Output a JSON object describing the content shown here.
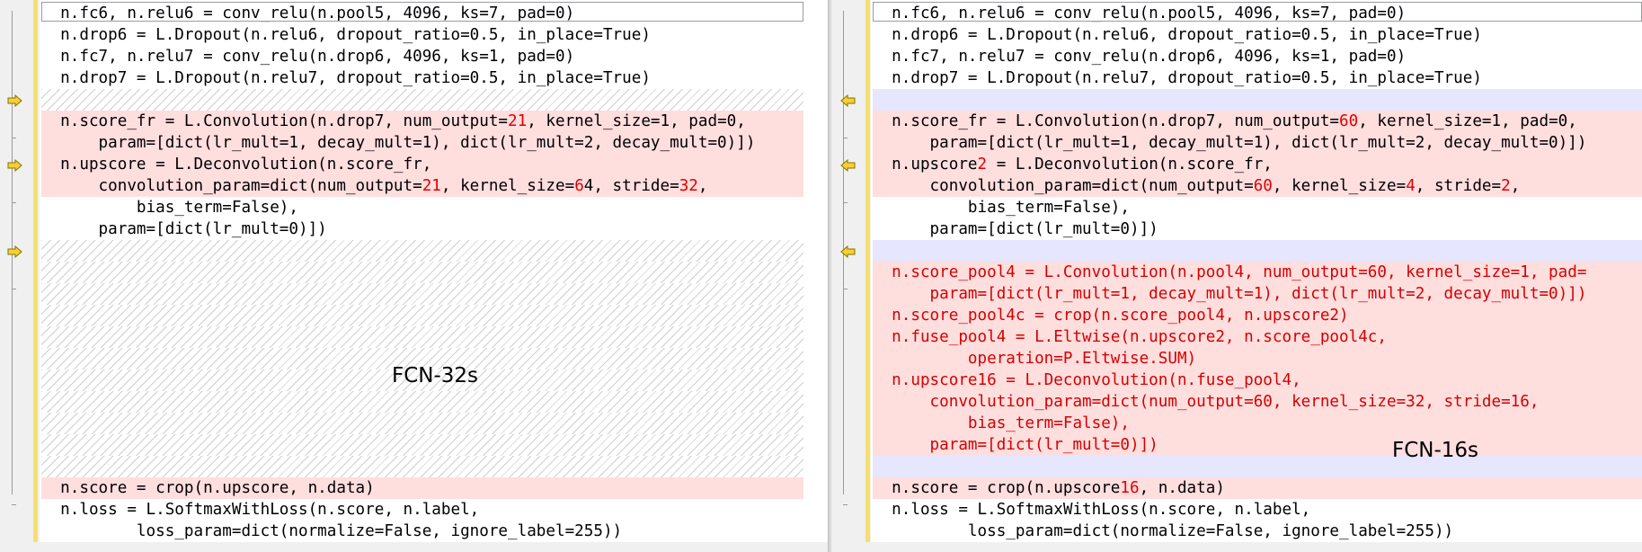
{
  "left": {
    "label": "FCN-32s",
    "lines": [
      {
        "kind": "normal",
        "spans": [
          {
            "t": "  n.fc6, n.relu6 = conv_relu(n.pool5, 4096, ks=7, pad=0)"
          }
        ]
      },
      {
        "kind": "normal",
        "spans": [
          {
            "t": "  n.drop6 = L.Dropout(n.relu6, dropout_ratio=0.5, in_place=True)"
          }
        ]
      },
      {
        "kind": "normal",
        "spans": [
          {
            "t": "  n.fc7, n.relu7 = conv_relu(n.drop6, 4096, ks=1, pad=0)"
          }
        ]
      },
      {
        "kind": "normal",
        "spans": [
          {
            "t": "  n.drop7 = L.Dropout(n.relu7, dropout_ratio=0.5, in_place=True)"
          }
        ]
      },
      {
        "kind": "hatch",
        "spans": []
      },
      {
        "kind": "changed",
        "spans": [
          {
            "t": "  n.score_fr = L.Convolution(n.drop7, num_output="
          },
          {
            "t": "21",
            "red": true
          },
          {
            "t": ", kernel_size=1, pad=0,"
          }
        ]
      },
      {
        "kind": "changed",
        "spans": [
          {
            "t": "      param=[dict(lr_mult=1, decay_mult=1), dict(lr_mult=2, decay_mult=0)])"
          }
        ]
      },
      {
        "kind": "changed",
        "spans": [
          {
            "t": "  n.upscore = L.Deconvolution(n.score_fr,"
          }
        ]
      },
      {
        "kind": "changed",
        "spans": [
          {
            "t": "      convolution_param=dict(num_output="
          },
          {
            "t": "21",
            "red": true
          },
          {
            "t": ", kernel_size="
          },
          {
            "t": "6",
            "red": true
          },
          {
            "t": "4, stride="
          },
          {
            "t": "32",
            "red": true
          },
          {
            "t": ","
          }
        ]
      },
      {
        "kind": "normal",
        "spans": [
          {
            "t": "          bias_term=False),"
          }
        ]
      },
      {
        "kind": "normal",
        "spans": [
          {
            "t": "      param=[dict(lr_mult=0)])"
          }
        ]
      },
      {
        "kind": "hatch",
        "spans": []
      },
      {
        "kind": "hatch",
        "spans": []
      },
      {
        "kind": "hatch",
        "spans": []
      },
      {
        "kind": "hatch",
        "spans": []
      },
      {
        "kind": "hatch",
        "spans": []
      },
      {
        "kind": "hatch",
        "spans": []
      },
      {
        "kind": "hatch",
        "spans": []
      },
      {
        "kind": "hatch",
        "spans": []
      },
      {
        "kind": "hatch",
        "spans": []
      },
      {
        "kind": "hatch",
        "spans": []
      },
      {
        "kind": "hatch",
        "spans": []
      },
      {
        "kind": "changed",
        "spans": [
          {
            "t": "  n.score = crop(n.upscore, n.data)"
          }
        ]
      },
      {
        "kind": "normal",
        "spans": [
          {
            "t": "  n.loss = L.SoftmaxWithLoss(n.score, n.label,"
          }
        ]
      },
      {
        "kind": "normal",
        "spans": [
          {
            "t": "          loss_param=dict(normalize=False, ignore_label=255))"
          }
        ]
      }
    ]
  },
  "right": {
    "label": "FCN-16s",
    "lines": [
      {
        "kind": "normal",
        "spans": [
          {
            "t": "  n.fc6, n.relu6 = conv_relu(n.pool5, 4096, ks=7, pad=0)"
          }
        ]
      },
      {
        "kind": "normal",
        "spans": [
          {
            "t": "  n.drop6 = L.Dropout(n.relu6, dropout_ratio=0.5, in_place=True)"
          }
        ]
      },
      {
        "kind": "normal",
        "spans": [
          {
            "t": "  n.fc7, n.relu7 = conv_relu(n.drop6, 4096, ks=1, pad=0)"
          }
        ]
      },
      {
        "kind": "normal",
        "spans": [
          {
            "t": "  n.drop7 = L.Dropout(n.relu7, dropout_ratio=0.5, in_place=True)"
          }
        ]
      },
      {
        "kind": "empty",
        "spans": []
      },
      {
        "kind": "changed",
        "spans": [
          {
            "t": "  n.score_fr = L.Convolution(n.drop7, num_output="
          },
          {
            "t": "60",
            "red": true
          },
          {
            "t": ", kernel_size=1, pad=0,"
          }
        ]
      },
      {
        "kind": "changed",
        "spans": [
          {
            "t": "      param=[dict(lr_mult=1, decay_mult=1), dict(lr_mult=2, decay_mult=0)])"
          }
        ]
      },
      {
        "kind": "changed",
        "spans": [
          {
            "t": "  n.upscore"
          },
          {
            "t": "2",
            "red": true
          },
          {
            "t": " = L.Deconvolution(n.score_fr,"
          }
        ]
      },
      {
        "kind": "changed",
        "spans": [
          {
            "t": "      convolution_param=dict(num_output="
          },
          {
            "t": "60",
            "red": true
          },
          {
            "t": ", kernel_size="
          },
          {
            "t": "4",
            "red": true
          },
          {
            "t": ", stride="
          },
          {
            "t": "2",
            "red": true
          },
          {
            "t": ","
          }
        ]
      },
      {
        "kind": "normal",
        "spans": [
          {
            "t": "          bias_term=False),"
          }
        ]
      },
      {
        "kind": "normal",
        "spans": [
          {
            "t": "      param=[dict(lr_mult=0)])"
          }
        ]
      },
      {
        "kind": "empty",
        "spans": []
      },
      {
        "kind": "added",
        "spans": [
          {
            "t": "  n.score_pool4 = L.Convolution(n.pool4, num_output=60, kernel_size=1, pad="
          }
        ]
      },
      {
        "kind": "added",
        "spans": [
          {
            "t": "      param=[dict(lr_mult=1, decay_mult=1), dict(lr_mult=2, decay_mult=0)])"
          }
        ]
      },
      {
        "kind": "added",
        "spans": [
          {
            "t": "  n.score_pool4c = crop(n.score_pool4, n.upscore2)"
          }
        ]
      },
      {
        "kind": "added",
        "spans": [
          {
            "t": "  n.fuse_pool4 = L.Eltwise(n.upscore2, n.score_pool4c,"
          }
        ]
      },
      {
        "kind": "added",
        "spans": [
          {
            "t": "          operation=P.Eltwise.SUM)"
          }
        ]
      },
      {
        "kind": "added",
        "spans": [
          {
            "t": "  n.upscore16 = L.Deconvolution(n.fuse_pool4,"
          }
        ]
      },
      {
        "kind": "added",
        "spans": [
          {
            "t": "      convolution_param=dict(num_output=60, kernel_size=32, stride=16,"
          }
        ]
      },
      {
        "kind": "added",
        "spans": [
          {
            "t": "          bias_term=False),"
          }
        ]
      },
      {
        "kind": "added",
        "spans": [
          {
            "t": "      param=[dict(lr_mult=0)])"
          }
        ]
      },
      {
        "kind": "empty",
        "spans": []
      },
      {
        "kind": "changed",
        "spans": [
          {
            "t": "  n.score = crop(n.upscore"
          },
          {
            "t": "16",
            "red": true
          },
          {
            "t": ", n.data)"
          }
        ]
      },
      {
        "kind": "normal",
        "spans": [
          {
            "t": "  n.loss = L.SoftmaxWithLoss(n.score, n.label,"
          }
        ]
      },
      {
        "kind": "normal",
        "spans": [
          {
            "t": "          loss_param=dict(normalize=False, ignore_label=255))"
          }
        ]
      }
    ]
  },
  "icons": {
    "diff_marker": "arrow-right-icon",
    "diff_marker_right": "arrow-left-icon"
  },
  "colors": {
    "changed_bg": "#ffdede",
    "empty_bg": "#e6e6ff",
    "changed_text": "#e00000",
    "marker": "#f5e06e"
  }
}
